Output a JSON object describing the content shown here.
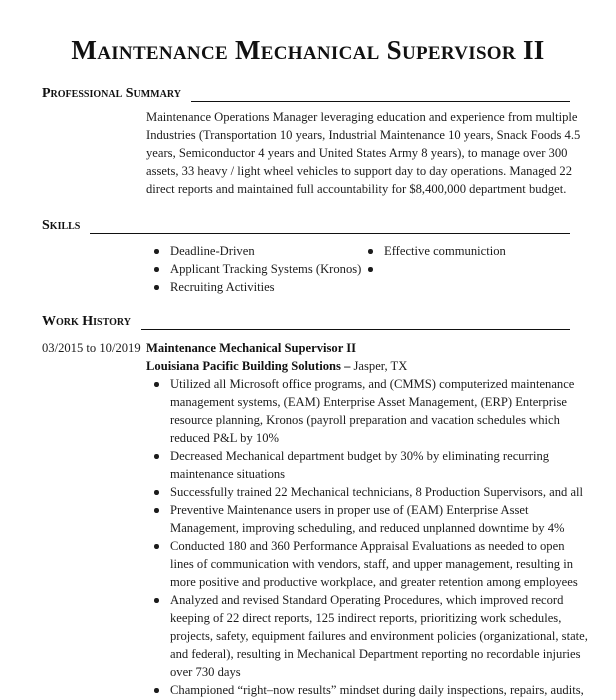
{
  "document": {
    "title": "Maintenance Mechanical Supervisor II"
  },
  "sections": {
    "summary": {
      "heading": "Professional Summary",
      "text": "Maintenance Operations Manager leveraging education and experience from multiple Industries (Transportation 10 years, Industrial Maintenance 10 years, Snack Foods 4.5 years, Semiconductor 4 years and United States Army 8 years), to manage over 300 assets, 33 heavy / light wheel vehicles to support day to day operations. Managed 22 direct reports and maintained full accountability for $8,400,000 department budget."
    },
    "skills": {
      "heading": "Skills",
      "column1": [
        "Deadline-Driven",
        "Applicant Tracking Systems (Kronos)",
        "Recruiting Activities"
      ],
      "column2": [
        "Effective communiction",
        ""
      ]
    },
    "work_history": {
      "heading": "Work History",
      "jobs": [
        {
          "dates": "03/2015 to 10/2019",
          "title": "Maintenance Mechanical Supervisor II",
          "company": "Louisiana Pacific Building Solutions",
          "separator": " – ",
          "location": "Jasper, TX",
          "bullets": [
            "Utilized all Microsoft office programs, and (CMMS) computerized maintenance management systems, (EAM) Enterprise Asset Management, (ERP) Enterprise resource planning, Kronos (payroll preparation and vacation schedules which reduced P&L by 10%",
            "Decreased Mechanical department budget by 30% by eliminating recurring maintenance situations",
            "Successfully trained 22 Mechanical technicians, 8 Production Supervisors, and all",
            "Preventive Maintenance users in proper use of (EAM) Enterprise Asset Management, improving scheduling, and reduced unplanned downtime by 4%",
            "Conducted 180 and 360 Performance Appraisal Evaluations as needed to open lines of communication with vendors, staff, and upper management, resulting in more positive and productive workplace, and greater retention among employees",
            "Analyzed and revised Standard Operating Procedures, which improved record keeping of 22 direct reports, 125 indirect reports, prioritizing work schedules, projects, safety, equipment failures and environment policies (organizational, state, and federal), resulting in Mechanical Department reporting no recordable injuries over 730 days",
            "Championed “right–now results” mindset during daily inspections, repairs, audits,"
          ]
        }
      ]
    }
  }
}
